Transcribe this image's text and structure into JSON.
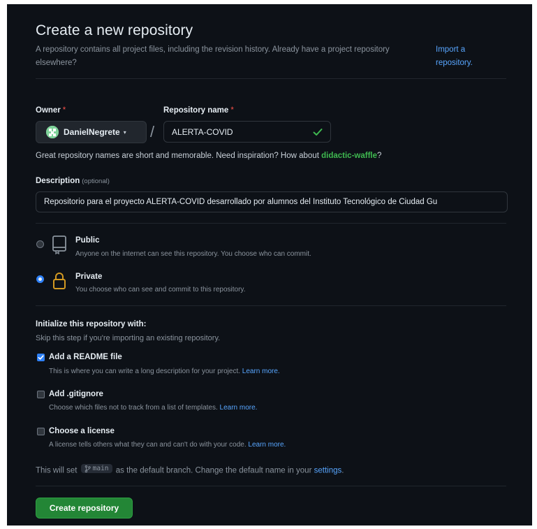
{
  "header": {
    "title": "Create a new repository",
    "intro": "A repository contains all project files, including the revision history. Already have a project repository elsewhere?",
    "import_line1": "Import a",
    "import_line2": "repository."
  },
  "owner": {
    "label": "Owner",
    "required_mark": "*",
    "value": "DanielNegrete",
    "caret": "▾"
  },
  "repo_name": {
    "label": "Repository name",
    "required_mark": "*",
    "value": "ALERTA-COVID",
    "separator": "/"
  },
  "name_hint": {
    "text": "Great repository names are short and memorable. Need inspiration? How about ",
    "suggestion": "didactic-waffle",
    "suffix": "?"
  },
  "description": {
    "label": "Description",
    "optional": "(optional)",
    "value": "Repositorio para el proyecto ALERTA-COVID desarrollado por alumnos del Instituto Tecnológico de Ciudad Gu"
  },
  "visibility": {
    "selected": "private",
    "public": {
      "title": "Public",
      "desc": "Anyone on the internet can see this repository. You choose who can commit."
    },
    "private": {
      "title": "Private",
      "desc": "You choose who can see and commit to this repository."
    }
  },
  "init": {
    "title": "Initialize this repository with:",
    "subtitle": "Skip this step if you're importing an existing repository.",
    "readme": {
      "checked": true,
      "title": "Add a README file",
      "desc": "This is where you can write a long description for your project. ",
      "link": "Learn more."
    },
    "gitignore": {
      "checked": false,
      "title": "Add .gitignore",
      "desc": "Choose which files not to track from a list of templates. ",
      "link": "Learn more."
    },
    "license": {
      "checked": false,
      "title": "Choose a license",
      "desc": "A license tells others what they can and can't do with your code. ",
      "link": "Learn more."
    }
  },
  "default_branch": {
    "prefix": "This will set",
    "branch": "main",
    "middle": "as the default branch. Change the default name in your",
    "link": "settings",
    "suffix": "."
  },
  "submit": {
    "label": "Create repository"
  },
  "colors": {
    "background": "#0d1117",
    "accent_green": "#238636",
    "link_blue": "#58a6ff",
    "suggestion_green": "#3fb950",
    "required_red": "#f85149",
    "radio_blue": "#2f81f7"
  },
  "icons": {
    "owner_avatar": "avatar-icon",
    "name_valid": "check-icon",
    "public": "repo-icon",
    "private": "lock-icon",
    "branch": "git-branch-icon"
  }
}
